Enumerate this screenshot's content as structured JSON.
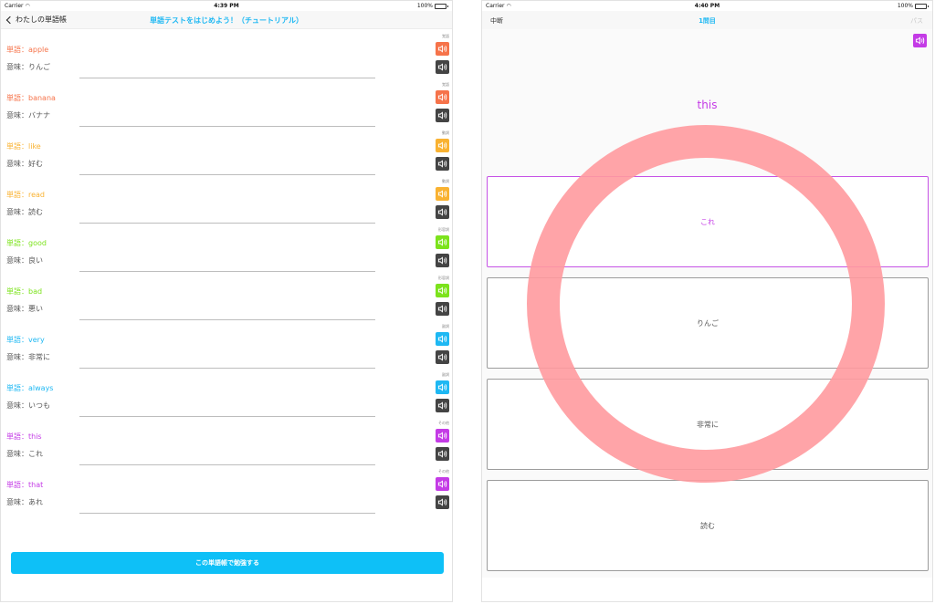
{
  "left": {
    "status": {
      "carrier": "Carrier",
      "time": "4:39 PM",
      "battery": "100%"
    },
    "nav": {
      "back_label": "わたしの単語帳",
      "title": "単語テストをはじめよう！（チュートリアル）"
    },
    "items": [
      {
        "word": "単語：apple",
        "meaning": "意味：りんご",
        "tag": "覚語",
        "color": "#f6734a"
      },
      {
        "word": "単語：banana",
        "meaning": "意味：バナナ",
        "tag": "覚語",
        "color": "#f6734a"
      },
      {
        "word": "単語：like",
        "meaning": "意味：好む",
        "tag": "動詞",
        "color": "#f9b231"
      },
      {
        "word": "単語：read",
        "meaning": "意味：読む",
        "tag": "動詞",
        "color": "#f9b231"
      },
      {
        "word": "単語：good",
        "meaning": "意味：良い",
        "tag": "形容詞",
        "color": "#7ce31c"
      },
      {
        "word": "単語：bad",
        "meaning": "意味：悪い",
        "tag": "形容詞",
        "color": "#7ce31c"
      },
      {
        "word": "単語：very",
        "meaning": "意味：非常に",
        "tag": "副詞",
        "color": "#1eb8f3"
      },
      {
        "word": "単語：always",
        "meaning": "意味：いつも",
        "tag": "副詞",
        "color": "#1eb8f3"
      },
      {
        "word": "単語：this",
        "meaning": "意味：これ",
        "tag": "その他",
        "color": "#c43be6"
      },
      {
        "word": "単語：that",
        "meaning": "意味：あれ",
        "tag": "その他",
        "color": "#c43be6"
      }
    ],
    "study_button": "この単語帳で勉強する"
  },
  "right": {
    "status": {
      "carrier": "Carrier",
      "time": "4:40 PM",
      "battery": "100%"
    },
    "nav": {
      "left": "中断",
      "title": "1問目",
      "right": "パス"
    },
    "question": "this",
    "question_color": "#c43be6",
    "choices": [
      {
        "label": "これ",
        "selected": true
      },
      {
        "label": "りんご",
        "selected": false
      },
      {
        "label": "非常に",
        "selected": false
      },
      {
        "label": "読む",
        "selected": false
      }
    ],
    "correct_mark_color": "#ff9a9e"
  }
}
